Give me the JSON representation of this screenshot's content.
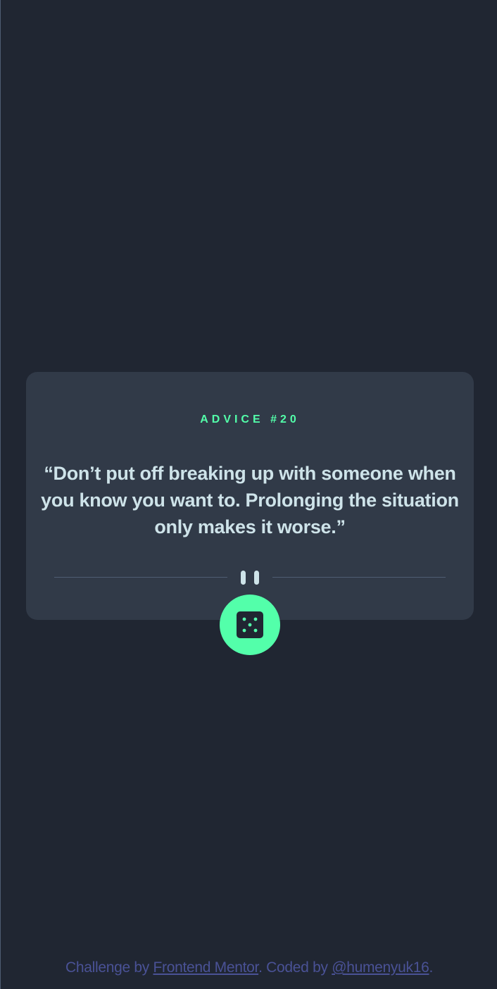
{
  "advice": {
    "label": "ADVICE #20",
    "quote": "“Don’t put off breaking up with someone when you know you want to. Prolonging the situation only makes it worse.”"
  },
  "button": {
    "icon": "dice-icon"
  },
  "footer": {
    "prefix": "Challenge by ",
    "link1": "Frontend Mentor",
    "middle": ". Coded by ",
    "link2": "@humenyuk16",
    "suffix": "."
  },
  "colors": {
    "background": "#202632",
    "card": "#313a48",
    "accent": "#53ffaa",
    "quote_text": "#cee3e9",
    "footer_text": "#4a5296"
  }
}
